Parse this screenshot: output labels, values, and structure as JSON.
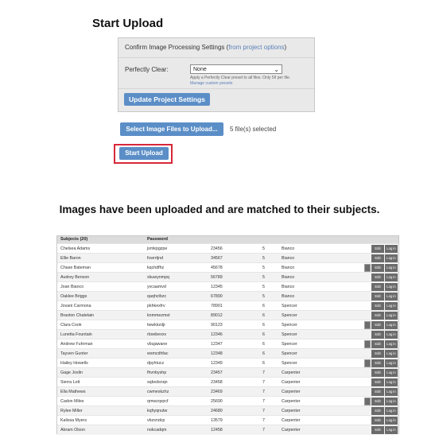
{
  "heading_upload": "Start Upload",
  "settings": {
    "confirm_text": "Confirm Image Processing Settings (",
    "confirm_link": "from project options",
    "confirm_close": ")",
    "perfectly_clear_label": "Perfectly Clear:",
    "perfectly_clear_value": "None",
    "help_text": "Apply a Perfectly Clear preset to all files. Only 5¢ per file.",
    "manage_link": "Manage custom presets",
    "update_button": "Update Project Settings"
  },
  "upload": {
    "select_button": "Select Image Files to Upload...",
    "selected_text": "5 file(s) selected",
    "start_button": "Start Upload"
  },
  "heading_matched": "Images have been uploaded and are matched to their subjects.",
  "table": {
    "header_subjects": "Subjects (20)",
    "header_password": "Password",
    "edit_label": "Edit",
    "login_label": "Log in",
    "rows": [
      {
        "name": "Chelsea Adams",
        "password": "jxmkpgzpe",
        "id": "23456",
        "grade": "5",
        "teacher": "Bianco",
        "thumb": false
      },
      {
        "name": "Ellie Baron",
        "password": "fcwrrtjnd",
        "id": "34567",
        "grade": "5",
        "teacher": "Bianco",
        "thumb": false
      },
      {
        "name": "Chase Bateman",
        "password": "kqchdfhz",
        "id": "45678",
        "grade": "5",
        "teacher": "Bianco",
        "thumb": true
      },
      {
        "name": "Audrey Benson",
        "password": "xkuwynmpq",
        "id": "56789",
        "grade": "5",
        "teacher": "Bianco",
        "thumb": false
      },
      {
        "name": "Joan Bianco",
        "password": "yvcaamvd",
        "id": "12345",
        "grade": "5",
        "teacher": "Bianco",
        "thumb": false
      },
      {
        "name": "Oaklee Briggs",
        "password": "qaqhctbzc",
        "id": "67890",
        "grade": "5",
        "teacher": "Bianco",
        "thumb": false
      },
      {
        "name": "Jovani Carmona",
        "password": "pkhkexfrv",
        "id": "78901",
        "grade": "6",
        "teacher": "Spencer",
        "thumb": false
      },
      {
        "name": "Braxton Chatelain",
        "password": "knmmezmst",
        "id": "89012",
        "grade": "6",
        "teacher": "Spencer",
        "thumb": false
      },
      {
        "name": "Clara Cook",
        "password": "twwkkzdjr",
        "id": "90123",
        "grade": "6",
        "teacher": "Spencer",
        "thumb": true
      },
      {
        "name": "Lunetta Fountain",
        "password": "rbxebexxv",
        "id": "12346",
        "grade": "6",
        "teacher": "Spencer",
        "thumb": false
      },
      {
        "name": "Andrew Fuhrman",
        "password": "vbujawane",
        "id": "12347",
        "grade": "6",
        "teacher": "Spencer",
        "thumb": true
      },
      {
        "name": "Tayven Gunter",
        "password": "wsmcdhfac",
        "id": "12348",
        "grade": "6",
        "teacher": "Spencer",
        "thumb": false
      },
      {
        "name": "Hailey Howells",
        "password": "dpyhtucz",
        "id": "12349",
        "grade": "6",
        "teacher": "Spencer",
        "thumb": true
      },
      {
        "name": "Gage Joslin",
        "password": "fhvnbyshp",
        "id": "23457",
        "grade": "7",
        "teacher": "Carpenter",
        "thumb": false
      },
      {
        "name": "Sierra Lott",
        "password": "sqbxdsnqn",
        "id": "23458",
        "grade": "7",
        "teacher": "Carpenter",
        "thumb": false
      },
      {
        "name": "Ella Mathews",
        "password": "cwmeskzhz",
        "id": "23469",
        "grade": "7",
        "teacher": "Carpenter",
        "thumb": false
      },
      {
        "name": "Cadon Miles",
        "password": "qmwzqvpcf",
        "id": "25690",
        "grade": "7",
        "teacher": "Carpenter",
        "thumb": true
      },
      {
        "name": "Rylee Miller",
        "password": "kqhyqnutw",
        "id": "24680",
        "grade": "7",
        "teacher": "Carpenter",
        "thumb": false
      },
      {
        "name": "Kalissa Myers",
        "password": "vbzxndcp",
        "id": "13579",
        "grade": "7",
        "teacher": "Carpenter",
        "thumb": false
      },
      {
        "name": "Abram Olson",
        "password": "nokcadqm",
        "id": "12458",
        "grade": "7",
        "teacher": "Carpenter",
        "thumb": false
      }
    ]
  }
}
